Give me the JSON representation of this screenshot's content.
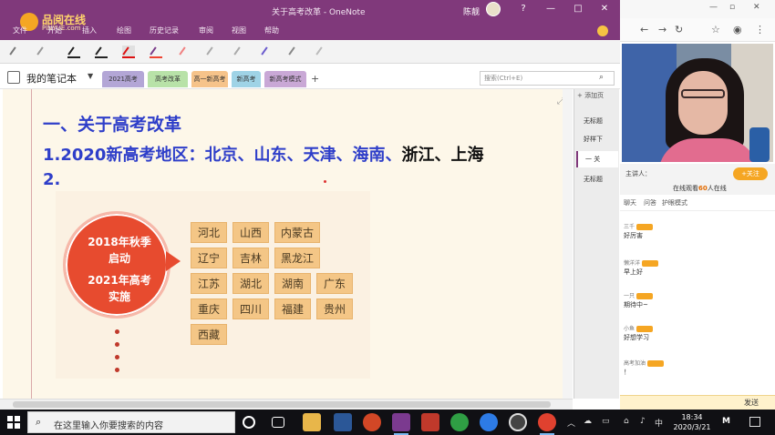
{
  "onenote": {
    "brand": "品阅在线",
    "brand_sub": "PINYUE.com",
    "title": "关于高考改革 - OneNote",
    "user": "陈靓",
    "window_buttons": [
      "?",
      "—",
      "□",
      "✕"
    ],
    "ribbon_tabs": [
      "文件",
      "开始",
      "插入",
      "绘图",
      "历史记录",
      "审阅",
      "视图",
      "帮助"
    ],
    "notebook_name": "我的笔记本",
    "sections": [
      {
        "label": "2021高考",
        "color": "#b3a6d6"
      },
      {
        "label": "高考改革",
        "color": "#b8e2a8"
      },
      {
        "label": "高一新高考",
        "color": "#f6c38a"
      },
      {
        "label": "新高考",
        "color": "#9fd3e6"
      },
      {
        "label": "新高考模式",
        "color": "#c9a8d6"
      }
    ],
    "search_placeholder": "搜索(Ctrl+E)",
    "page": {
      "heading": "一、关于高考改革",
      "line2_prefix": "1.2020新高考地区：北京、山东、天津、海南、",
      "line2_black": "浙江、上海",
      "line3": "2."
    },
    "slide": {
      "bubble_line1": "2018年秋季",
      "bubble_line2": "启动",
      "bubble_line3": "2021年高考",
      "bubble_line4": "实施",
      "provinces": [
        [
          "河北",
          "山西",
          "内蒙古"
        ],
        [
          "辽宁",
          "吉林",
          "黑龙江"
        ],
        [
          "江苏",
          "湖北",
          "湖南",
          "广东"
        ],
        [
          "重庆",
          "四川",
          "福建",
          "贵州"
        ],
        [
          "西藏"
        ]
      ]
    },
    "pages_panel": {
      "add_page": "+ 添加页",
      "items": [
        "无标题",
        "好样下",
        "一 关",
        "无标题"
      ]
    }
  },
  "live": {
    "host": "主讲人：",
    "follow": "+关注",
    "online_prefix": "在线观看",
    "online_count": "60",
    "online_suffix": "人在线",
    "chat_tabs": [
      "聊天",
      "问答",
      "护眼模式"
    ],
    "messages": [
      {
        "name": "三千",
        "text": "好厉害"
      },
      {
        "name": "懒洋洋",
        "text": "早上好"
      },
      {
        "name": "一只",
        "text": "期待中~"
      },
      {
        "name": "小鱼",
        "text": "好想学习"
      },
      {
        "name": "高考加油",
        "text": "！"
      }
    ],
    "send_label": "发送"
  },
  "taskbar": {
    "search_placeholder": "在这里输入你要搜索的内容",
    "time": "18:34",
    "date": "2020/3/21",
    "ime": "中"
  }
}
